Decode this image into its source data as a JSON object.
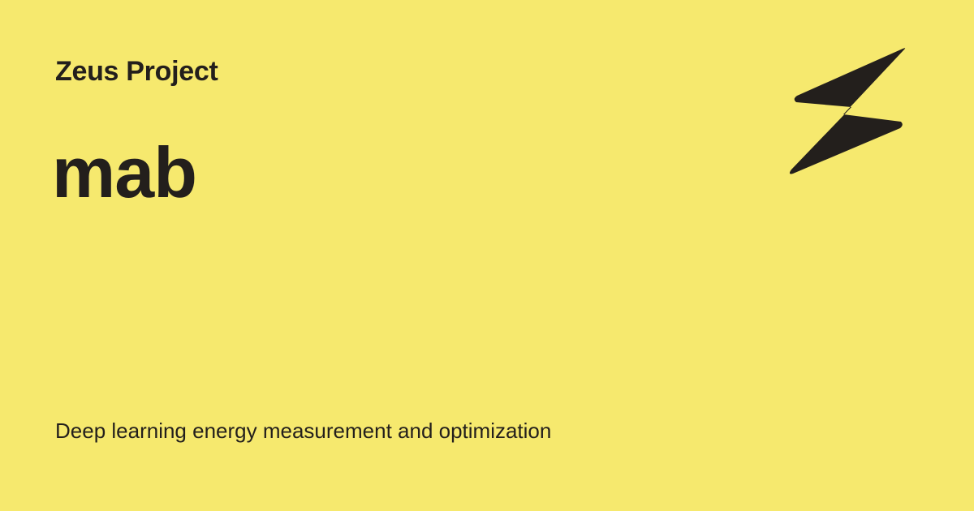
{
  "header": {
    "site_name": "Zeus Project"
  },
  "page": {
    "title": "mab",
    "description": "Deep learning energy measurement and optimization"
  },
  "colors": {
    "background": "#f6e96e",
    "text": "#231f1c",
    "logo": "#231f1c"
  },
  "logo": {
    "icon": "lightning-bolt-icon"
  }
}
